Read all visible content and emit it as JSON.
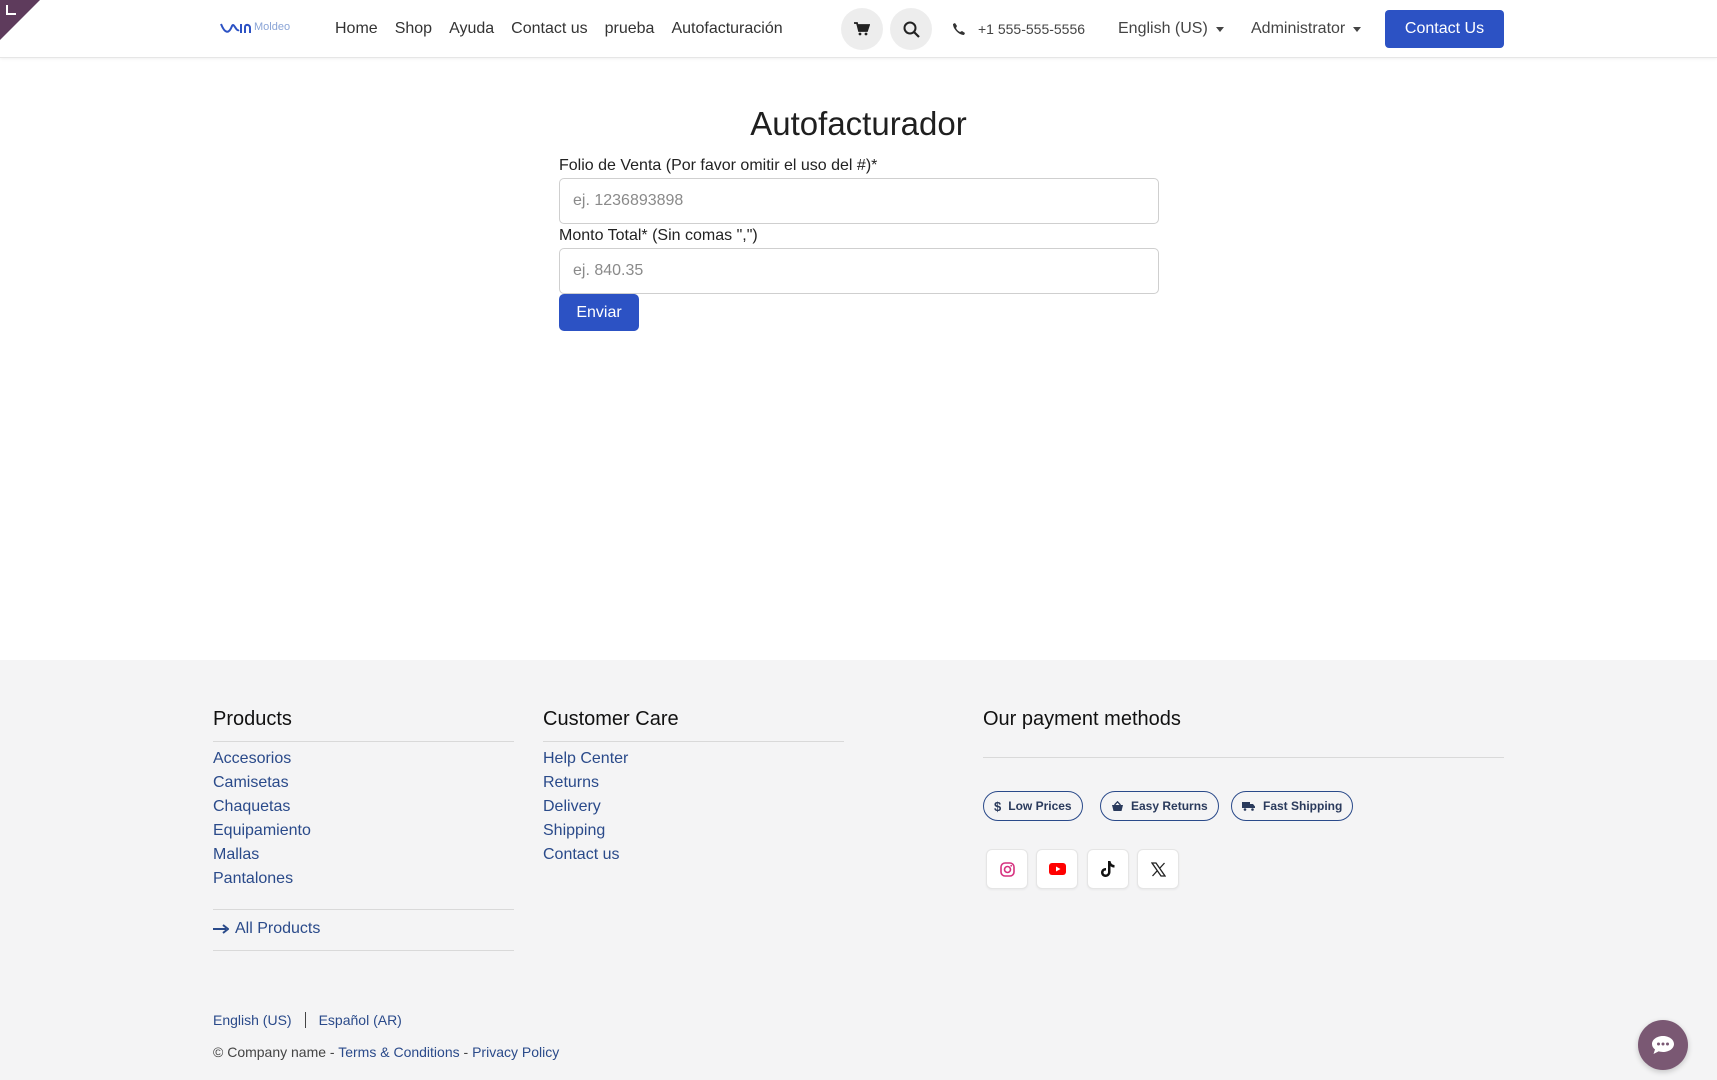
{
  "header": {
    "logo_text": "Moldeo",
    "nav": [
      "Home",
      "Shop",
      "Ayuda",
      "Contact us",
      "prueba",
      "Autofacturación"
    ],
    "phone": "+1 555-555-5556",
    "language": "English (US)",
    "user": "Administrator",
    "contact_button": "Contact Us"
  },
  "form": {
    "title": "Autofacturador",
    "folio_label": "Folio de Venta (Por favor omitir el uso del #)*",
    "folio_placeholder": "ej. 1236893898",
    "monto_label": "Monto Total* (Sin comas \",\")",
    "monto_placeholder": "ej. 840.35",
    "submit_label": "Enviar"
  },
  "footer": {
    "products_title": "Products",
    "products": [
      "Accesorios",
      "Camisetas",
      "Chaquetas",
      "Equipamiento",
      "Mallas",
      "Pantalones"
    ],
    "all_products": "All Products",
    "care_title": "Customer Care",
    "care": [
      "Help Center",
      "Returns",
      "Delivery",
      "Shipping",
      "Contact us"
    ],
    "payment_title": "Our payment methods",
    "badges": [
      "Low Prices",
      "Easy Returns",
      "Fast Shipping"
    ],
    "social": [
      "instagram-icon",
      "youtube-icon",
      "tiktok-icon",
      "x-icon"
    ],
    "languages": [
      "English (US)",
      "Español (AR)"
    ],
    "copyright_prefix": "© Company name - ",
    "terms": "Terms & Conditions",
    "dash": " - ",
    "privacy": "Privacy Policy"
  },
  "colors": {
    "primary": "#2c52c4",
    "link": "#2a4a8a",
    "chat": "#7a5873",
    "footer_bg": "#f4f4f5"
  }
}
